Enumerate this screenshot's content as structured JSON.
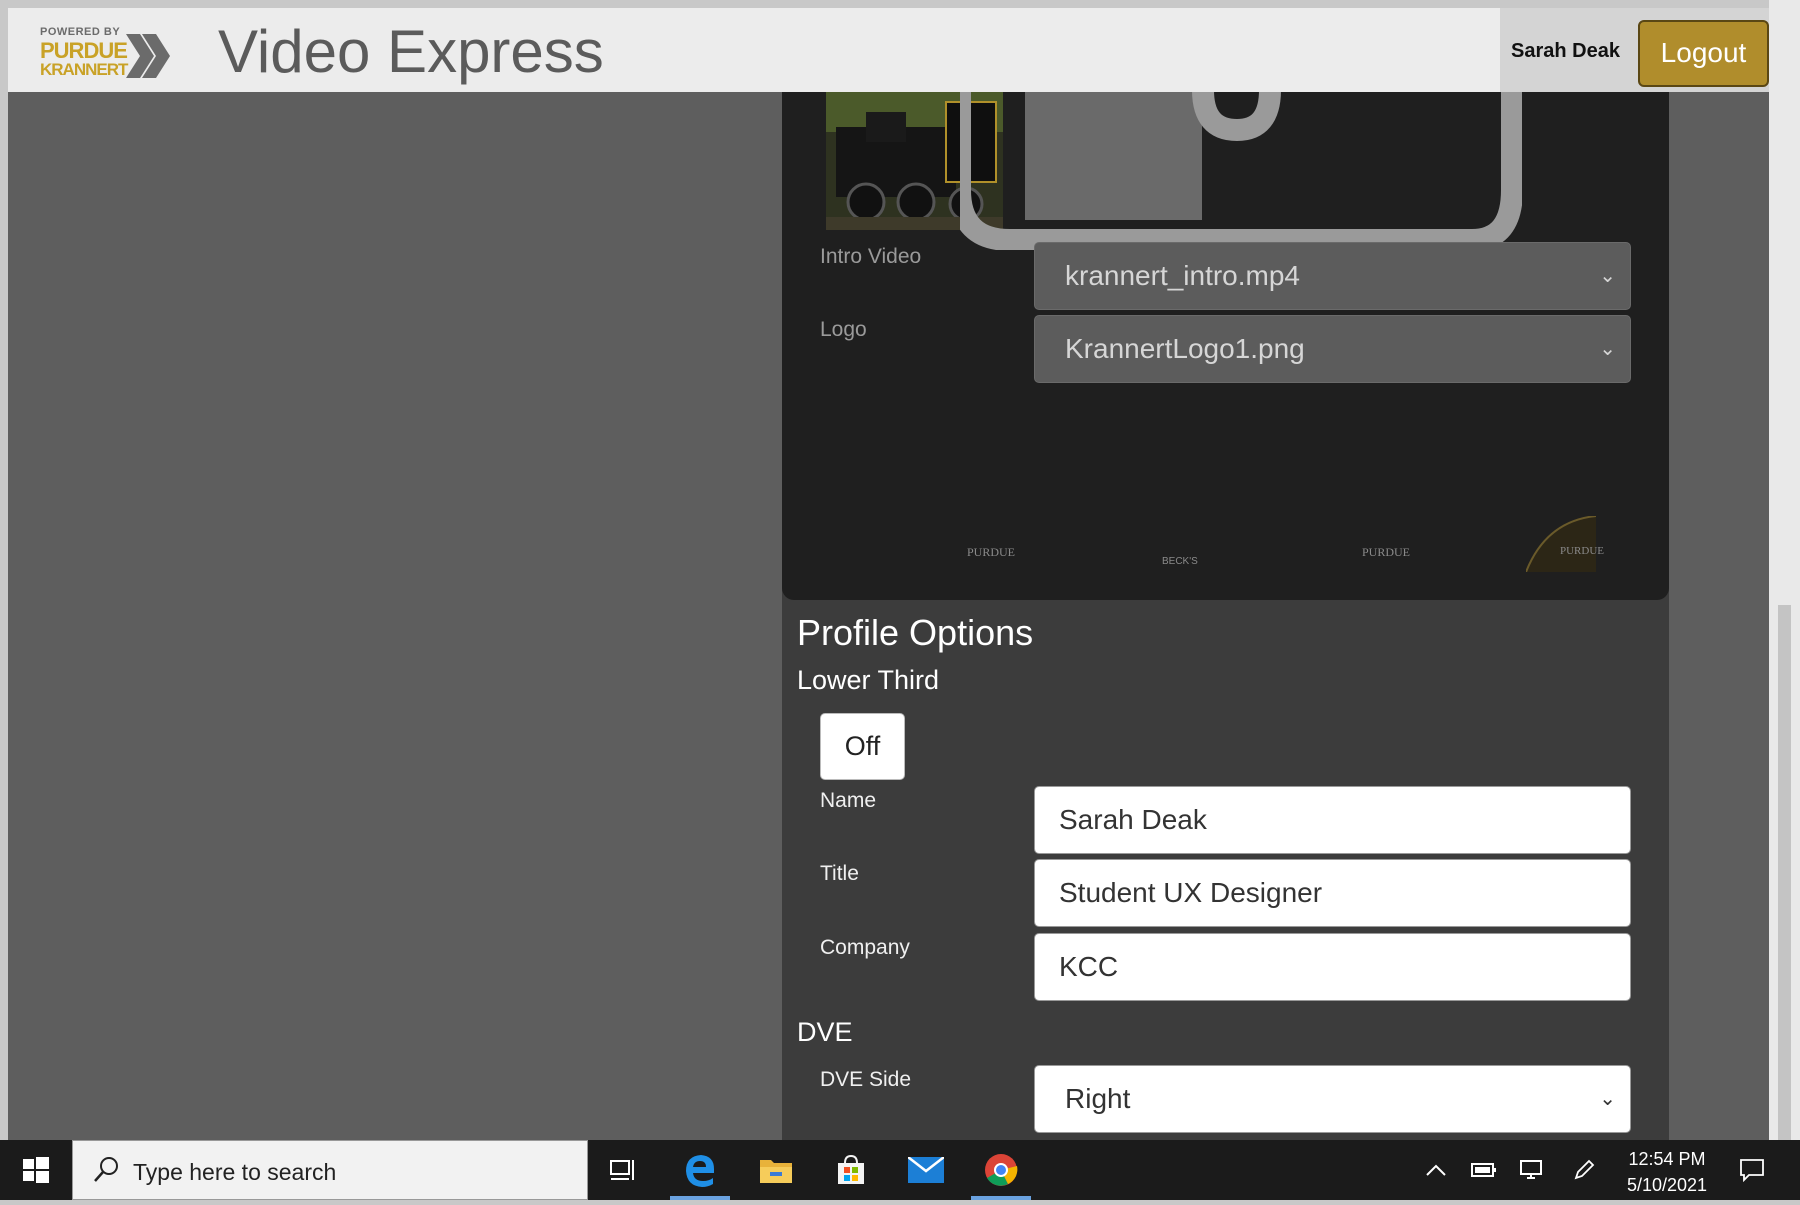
{
  "header": {
    "brand_powered": "POWERED BY",
    "brand_purdue": "PURDUE",
    "brand_krannert": "KRANNERT",
    "app_title": "Video Express",
    "user_name": "Sarah Deak",
    "logout_label": "Logout"
  },
  "media": {
    "intro_video_label": "Intro Video",
    "intro_video_value": "krannert_intro.mp4",
    "logo_label": "Logo",
    "logo_value": "KrannertLogo1.png",
    "sponsors": [
      "PURDUE",
      "BECK'S",
      "PURDUE",
      "PURDUE"
    ]
  },
  "profile": {
    "title": "Profile Options",
    "lower_third": {
      "heading": "Lower Third",
      "toggle_label": "Off",
      "name_label": "Name",
      "name_value": "Sarah Deak",
      "title_label": "Title",
      "title_value": "Student UX Designer",
      "company_label": "Company",
      "company_value": "KCC"
    },
    "dve": {
      "heading": "DVE",
      "side_label": "DVE Side",
      "side_value": "Right"
    }
  },
  "taskbar": {
    "search_placeholder": "Type here to search",
    "time": "12:54 PM",
    "date": "5/10/2021"
  },
  "colors": {
    "accent": "#b08d2c",
    "brand_gold": "#c9a227",
    "panel": "#3c3c3c",
    "preview": "#1f1f1f"
  }
}
